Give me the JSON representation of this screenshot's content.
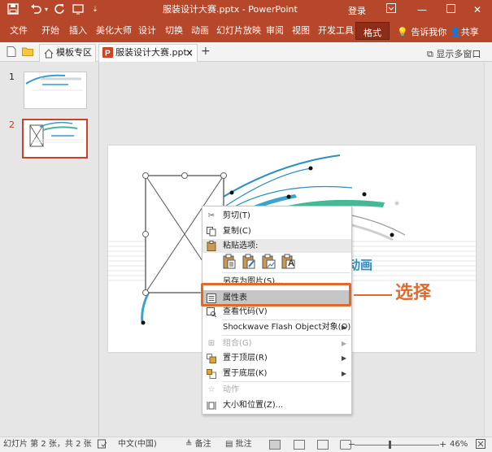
{
  "titlebar": {
    "title": "服装设计大赛.pptx  -  PowerPoint",
    "login": "登录",
    "quick_access": {
      "save_icon": "save-icon",
      "undo_icon": "undo-icon",
      "redo_icon": "redo-icon",
      "customize_icon": "customize-icon"
    },
    "window_buttons": [
      "ribbon-options-icon",
      "minimize-icon",
      "maximize-icon",
      "close-icon"
    ]
  },
  "ribbon": {
    "tabs": [
      "文件",
      "开始",
      "插入",
      "美化大师",
      "设计",
      "切换",
      "动画",
      "幻灯片放映",
      "审阅",
      "视图",
      "开发工具"
    ],
    "active_tab": "格式",
    "tell_me": "告诉我你",
    "share": "共享",
    "accent_color": "#b7472a"
  },
  "tabstrip": {
    "tabs": [
      {
        "label": "模板专区",
        "icon": "home-icon"
      },
      {
        "label": "服装设计大赛.pptx",
        "icon": "powerpoint-icon",
        "close": "×"
      }
    ],
    "new_tab": "+",
    "multi_window": "显示多窗口"
  },
  "thumbnails": [
    {
      "number": "1"
    },
    {
      "number": "2",
      "selected": true
    }
  ],
  "slide": {
    "partial_title": "动画"
  },
  "context_menu": {
    "items": [
      {
        "label": "剪切(T)",
        "icon": "cut-icon",
        "enabled": true
      },
      {
        "label": "复制(C)",
        "icon": "copy-icon",
        "enabled": true
      },
      {
        "label": "粘贴选项:",
        "icon": "paste-icon",
        "enabled": true,
        "header": true
      },
      {
        "label": "另存为图片(S)...",
        "enabled": true
      },
      {
        "label": "属性表",
        "icon": "properties-icon",
        "enabled": true,
        "highlighted": true
      },
      {
        "label": "查看代码(V)",
        "icon": "view-code-icon",
        "enabled": true
      },
      {
        "label": "Shockwave Flash Object对象(O)",
        "enabled": true,
        "submenu": true
      },
      {
        "label": "组合(G)",
        "icon": "group-icon",
        "enabled": false,
        "submenu": true
      },
      {
        "label": "置于顶层(R)",
        "icon": "bring-to-front-icon",
        "enabled": true,
        "submenu": true
      },
      {
        "label": "置于底层(K)",
        "icon": "send-to-back-icon",
        "enabled": true,
        "submenu": true
      },
      {
        "label": "动作",
        "icon": "action-icon",
        "enabled": false
      },
      {
        "label": "大小和位置(Z)...",
        "icon": "size-position-icon",
        "enabled": true
      }
    ],
    "paste_icons": [
      "paste-use-destination-icon",
      "paste-keep-source-icon",
      "paste-picture-icon",
      "paste-text-only-icon"
    ],
    "paste_icon_letter": "A"
  },
  "annotation": {
    "callout": "选择",
    "color": "#e06a2c"
  },
  "statusbar": {
    "slide_info": "幻灯片 第 2 张，共 2 张",
    "language": "中文(中国)",
    "notes": "备注",
    "comments": "批注",
    "zoom": "46%",
    "zoom_minus": "−",
    "zoom_plus": "+"
  }
}
